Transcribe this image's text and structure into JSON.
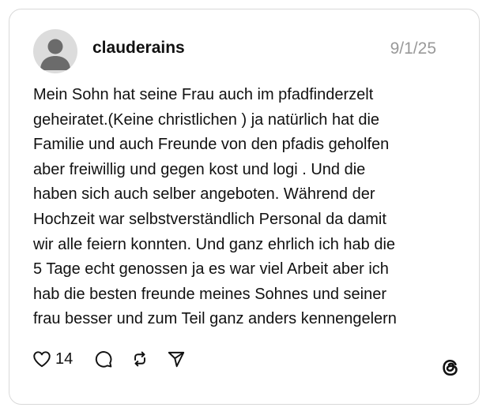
{
  "post": {
    "username": "clauderains",
    "timestamp": "9/1/25",
    "text_lines": [
      "Mein Sohn hat seine Frau auch im pfadfinderzelt",
      "geheiratet.(Keine christlichen ) ja natürlich hat die",
      "Familie und auch Freunde von den pfadis geholfen",
      "aber freiwillig und gegen kost und logi . Und die",
      "haben sich auch selber angeboten. Während der",
      "Hochzeit war selbstverständlich Personal da damit",
      "wir alle feiern konnten. Und ganz ehrlich ich hab die",
      "5 Tage echt genossen ja es war viel Arbeit aber ich",
      "hab die besten freunde meines Sohnes und seiner",
      "frau besser und zum Teil ganz anders kennengelern"
    ]
  },
  "actions": {
    "like_count": "14",
    "icons": [
      "heart-icon",
      "comment-icon",
      "repost-icon",
      "share-icon"
    ]
  },
  "branding": {
    "logo": "threads-logo-icon"
  },
  "colors": {
    "text": "#111111",
    "muted": "#999999",
    "border": "#d9d9d9",
    "avatar_bg": "#dcdcdc",
    "avatar_fg": "#6b6b6b"
  }
}
